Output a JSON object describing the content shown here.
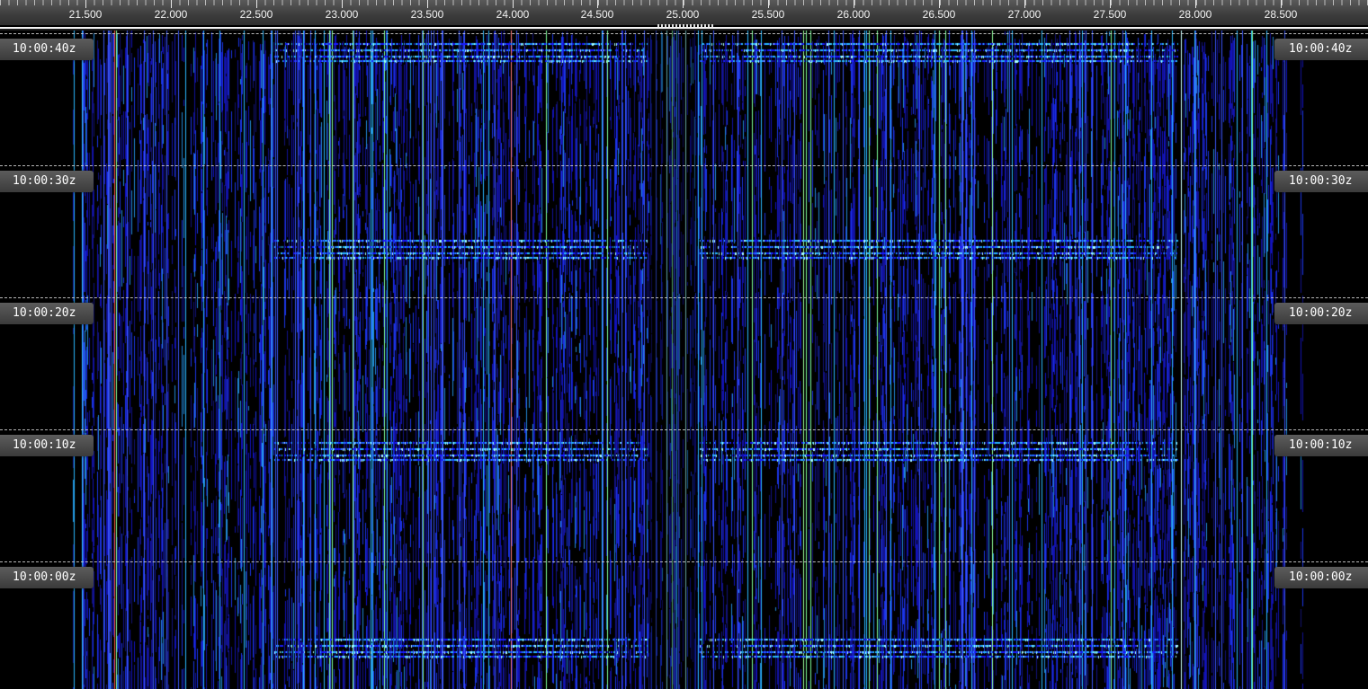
{
  "frequency_scale": {
    "labels": [
      "21.500",
      "22.000",
      "22.500",
      "23.000",
      "23.500",
      "24.000",
      "24.500",
      "25.000",
      "25.500",
      "26.000",
      "26.500",
      "27.000",
      "27.500",
      "28.000",
      "28.500"
    ]
  },
  "time_markers": [
    "10:00:40z",
    "10:00:30z",
    "10:00:20z",
    "10:00:10z",
    "10:00:00z"
  ],
  "colors": {
    "background": "#000000",
    "signal_low": "#1a1aff",
    "signal_mid": "#2ab8ff",
    "signal_high": "#aaffff",
    "carrier_green": "#7cff9a",
    "carrier_red": "#ff5a3c"
  }
}
